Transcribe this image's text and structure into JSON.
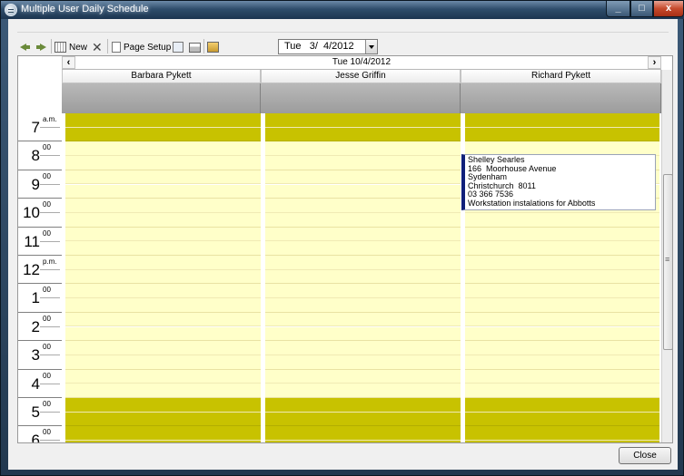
{
  "window": {
    "title": "Multiple User Daily Schedule",
    "controls": {
      "minimize": "_",
      "maximize": "□",
      "close": "x"
    }
  },
  "toolbar": {
    "new_label": "New",
    "page_setup_label": "Page Setup",
    "date_value": "Tue   3/  4/2012",
    "icons": [
      "arrow-left-icon",
      "arrow-right-icon",
      "calendar-icon",
      "delete-icon",
      "page-setup-icon",
      "print-preview-icon",
      "print-icon",
      "export-icon"
    ]
  },
  "scheduler": {
    "date_header": "Tue 10/4/2012",
    "nav_prev": "‹",
    "nav_next": "›",
    "resources": [
      "Barbara Pykett",
      "Jesse Griffin",
      "Richard Pykett"
    ],
    "hours": [
      {
        "hour": "7",
        "suffix": "a.m."
      },
      {
        "hour": "8",
        "suffix": "00"
      },
      {
        "hour": "9",
        "suffix": "00"
      },
      {
        "hour": "10",
        "suffix": "00"
      },
      {
        "hour": "11",
        "suffix": "00"
      },
      {
        "hour": "12",
        "suffix": "p.m."
      },
      {
        "hour": "1",
        "suffix": "00"
      },
      {
        "hour": "2",
        "suffix": "00"
      },
      {
        "hour": "3",
        "suffix": "00"
      },
      {
        "hour": "4",
        "suffix": "00"
      },
      {
        "hour": "5",
        "suffix": "00"
      },
      {
        "hour": "6",
        "suffix": "00"
      }
    ],
    "appointment": {
      "lines": [
        "Shelley Searles",
        "166  Moorhouse Avenue",
        "Sydenham",
        "Christchurch  8011",
        "03 366 7536",
        "Workstation instalations for Abbotts"
      ],
      "accent_color": "#10207a"
    },
    "colors": {
      "off_hours": "#c8c200",
      "work_hours": "#ffffc9"
    }
  },
  "footer": {
    "close_label": "Close"
  }
}
